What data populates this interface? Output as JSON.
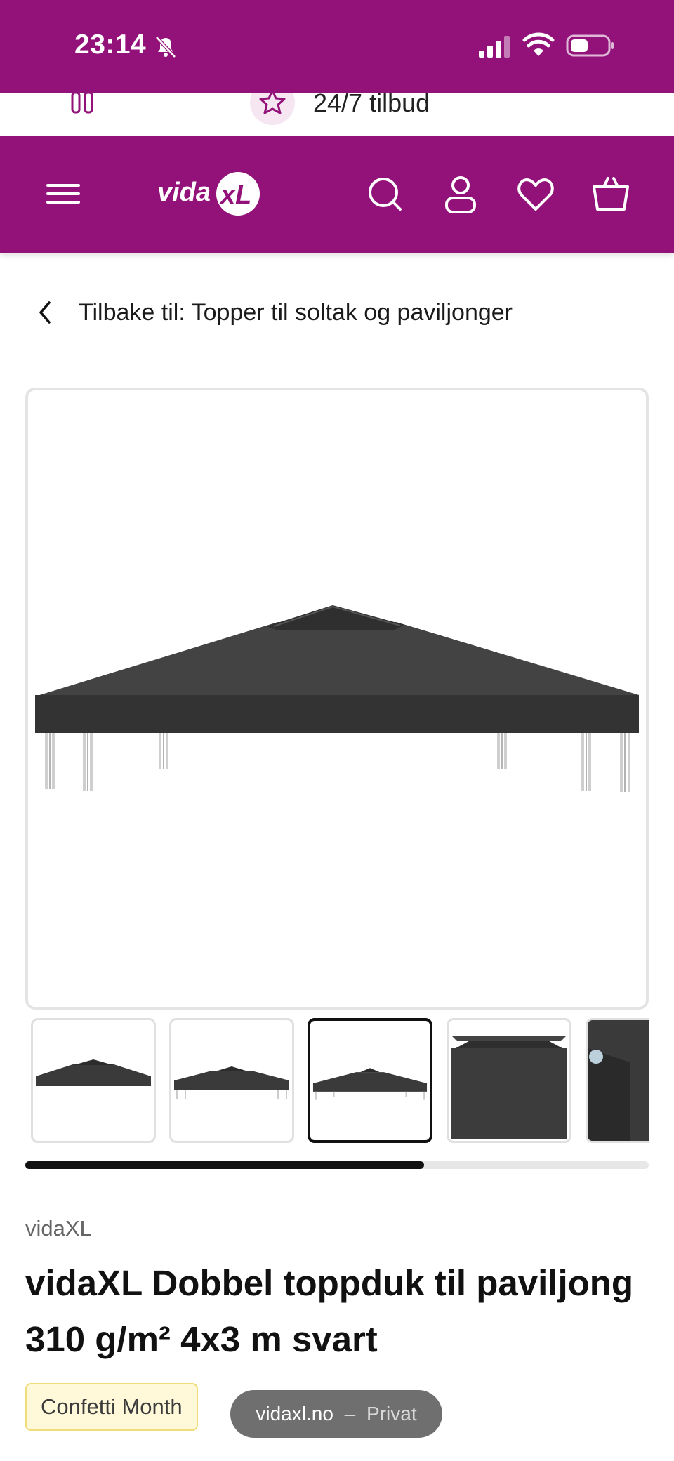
{
  "status_bar": {
    "time": "23:14",
    "icons": [
      "bell-muted-icon",
      "signal-icon",
      "wifi-icon",
      "battery-icon"
    ]
  },
  "promo": {
    "text": "24/7 tilbud",
    "icon": "star-icon"
  },
  "header": {
    "logo_text": "vidaXL",
    "icons": [
      "menu-icon",
      "search-icon",
      "account-icon",
      "heart-icon",
      "cart-icon"
    ]
  },
  "breadcrumb": {
    "label": "Tilbake til: Topper til soltak og paviljonger"
  },
  "gallery": {
    "thumbnail_count_visible": 5,
    "active_thumbnail_index": 2,
    "scroll_progress": 0.64
  },
  "product": {
    "brand": "vidaXL",
    "title": "vidaXL Dobbel toppduk til paviljong 310 g/m² 4x3 m svart",
    "badge": "Confetti Month"
  },
  "browser": {
    "domain": "vidaxl.no",
    "separator": "–",
    "mode": "Privat"
  },
  "colors": {
    "brand": "#93127a",
    "badge_bg": "#fff9d9",
    "product_canopy": "#3a3a3a"
  }
}
